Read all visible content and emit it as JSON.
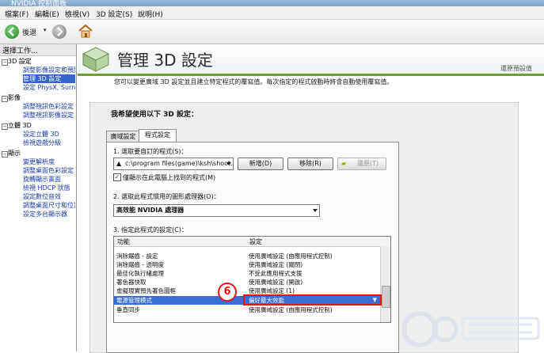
{
  "window": {
    "title": "NVIDIA 控制面板"
  },
  "menu": [
    "檔案(F)",
    "編輯(E)",
    "檢視(V)",
    "3D 設定(S)",
    "說明(H)"
  ],
  "toolbar": {
    "back_label": "後退"
  },
  "sidebar": {
    "header": "選擇工作...",
    "sections": [
      {
        "label": "3D 設定",
        "items": [
          "調整影像設定和預覽",
          "管理 3D 設定",
          "設定 PhysX, Surround"
        ]
      },
      {
        "label": "影像",
        "items": [
          "調整視訊色彩設定",
          "調整視訊影像設定"
        ]
      },
      {
        "label": "立體 3D",
        "items": [
          "設定立體 3D",
          "檢視遊戲分級"
        ]
      },
      {
        "label": "顯示",
        "items": [
          "變更解析度",
          "調整桌面色彩設定",
          "旋轉顯示畫面",
          "檢視 HDCP 狀態",
          "設定數位音效",
          "調整桌面尺寸和位置",
          "設定多台顯示器"
        ]
      }
    ]
  },
  "main": {
    "title": "管理 3D 設定",
    "restore_defaults": "還原預設值",
    "description": "您可以變更廣域 3D 設定並且建立特定程式的覆寫值。每次指定的程式啟動時將會自動使用覆寫值。",
    "group_label": "我希望使用以下 3D 設定：",
    "tabs": [
      "廣域設定",
      "程式設定"
    ],
    "step1": "1. 選取要自訂的程式(S)：",
    "program_value": "c:\\program files(game)\\ksh\\shoot...",
    "add_button": "新增(D)",
    "remove_button": "移除(R)",
    "restore_button": "還原(T)",
    "show_only_checkbox": "僅顯示在此電腦上找到的程式(M)",
    "step2": "2. 選取此程式慣用的圖形處理器(O)：",
    "processor_value": "高效能 NVIDIA 處理器",
    "step3": "3. 指定此程式的設定(C)：",
    "col_feature": "功能",
    "col_setting": "設定",
    "rows": [
      {
        "feature": "消除鋸齒 - 設定",
        "setting": "使用廣域設定 (由應用程式控制)"
      },
      {
        "feature": "消除鋸齒 - 透明度",
        "setting": "使用廣域設定 (關閉)"
      },
      {
        "feature": "最佳化執行緒處理",
        "setting": "不受此應用程式支援"
      },
      {
        "feature": "著色器快取",
        "setting": "使用廣域設定 (開啟)"
      },
      {
        "feature": "虛擬現實預先著色圖框",
        "setting": "使用廣域設定 (1)"
      },
      {
        "feature": "電源管理模式",
        "setting": "偏好最大效能"
      },
      {
        "feature": "垂直同步",
        "setting": "使用廣域設定 (由應用程式控制)"
      }
    ],
    "selected_row": 5,
    "annotation_number": "6"
  },
  "colors": {
    "accent_green": "#76b900",
    "selection_blue": "#3a6ed6",
    "annotation_red": "#e11111"
  }
}
